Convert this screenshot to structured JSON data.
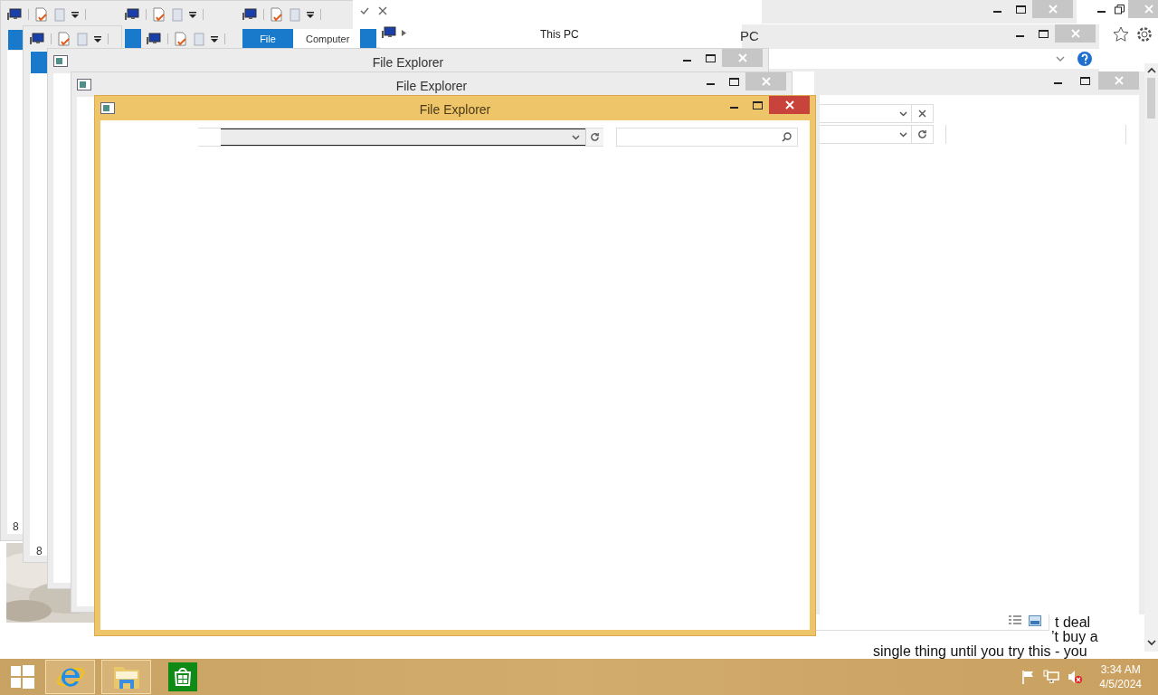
{
  "ribbon": {
    "tabs": [
      {
        "label": "File",
        "selected": true
      },
      {
        "label": "Computer",
        "selected": false
      }
    ]
  },
  "this_pc_window": {
    "breadcrumb": "This PC"
  },
  "pc_window": {
    "title": "PC"
  },
  "explorer_windows": [
    {
      "title": "File Explorer",
      "active": false
    },
    {
      "title": "File Explorer",
      "active": false
    },
    {
      "title": "File Explorer",
      "active": true
    }
  ],
  "side_labels": [
    "8",
    "8"
  ],
  "web_page": {
    "lines": [
      "t deal",
      "’t buy a",
      "single thing until you try this - you"
    ]
  },
  "taskbar": {
    "apps": [
      {
        "kind": "ie",
        "open": true
      },
      {
        "kind": "explorer",
        "open": true
      },
      {
        "kind": "store",
        "open": false
      }
    ],
    "tray": {
      "volume_muted": true
    },
    "clock": {
      "time": "3:34 AM",
      "date": "4/5/2024"
    }
  }
}
